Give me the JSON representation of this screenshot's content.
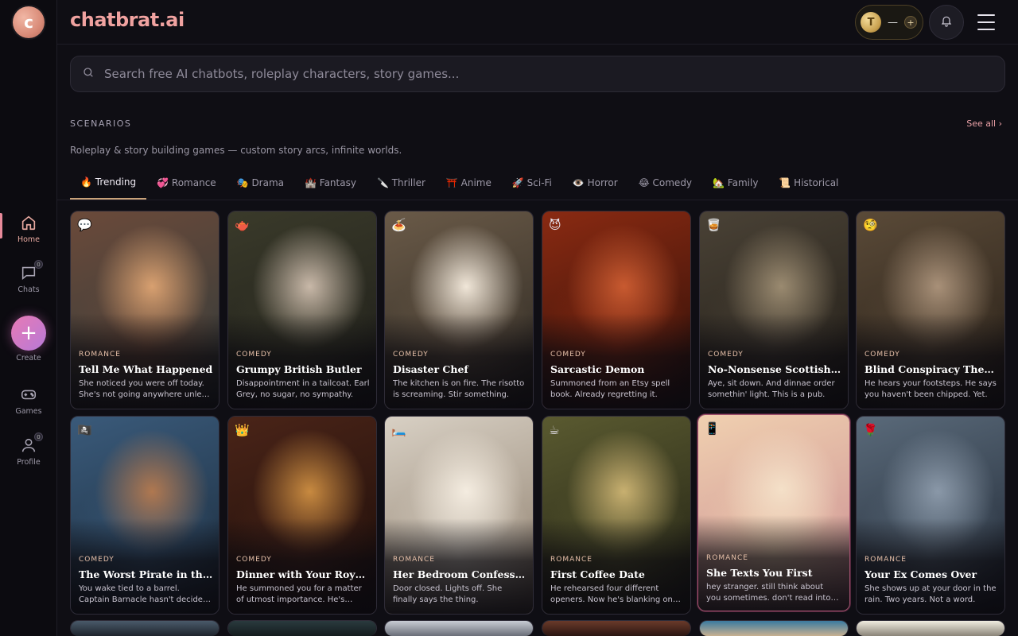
{
  "app": {
    "brand": "chatbrat.ai",
    "logo_letter": "c",
    "coins_value": "—",
    "coins_plus": "+"
  },
  "sidebar": {
    "items": [
      {
        "label": "Home",
        "icon": "home-icon",
        "active": true
      },
      {
        "label": "Chats",
        "icon": "chat-bubble-icon",
        "badge": "0"
      },
      {
        "label": "Create",
        "icon": "plus-icon"
      },
      {
        "label": "Games",
        "icon": "gamepad-icon"
      },
      {
        "label": "Profile",
        "icon": "user-icon",
        "badge": "0"
      }
    ]
  },
  "search": {
    "placeholder": "Search free AI chatbots, roleplay characters, story games..."
  },
  "section": {
    "title": "SCENARIOS",
    "see_all": "See all ›",
    "subtitle": "Roleplay & story building games — custom story arcs, infinite worlds."
  },
  "tabs": [
    {
      "label": "🔥 Trending",
      "active": true
    },
    {
      "label": "💞 Romance"
    },
    {
      "label": "🎭 Drama"
    },
    {
      "label": "🏰 Fantasy"
    },
    {
      "label": "🔪 Thriller"
    },
    {
      "label": "⛩️ Anime"
    },
    {
      "label": "🚀 Sci-Fi"
    },
    {
      "label": "👁️ Horror"
    },
    {
      "label": "😂 Comedy"
    },
    {
      "label": "🏡 Family"
    },
    {
      "label": "📜 Historical"
    }
  ],
  "cards": [
    {
      "emoji": "💬",
      "genre": "ROMANCE",
      "title": "Tell Me What Happened",
      "desc": "She noticed you were off today. She's not going anywhere unless you tell her.",
      "colors": [
        "#6b4a3a",
        "#2e3a3a",
        "#d8a070"
      ]
    },
    {
      "emoji": "🫖",
      "genre": "COMEDY",
      "title": "Grumpy British Butler",
      "desc": "Disappointment in a tailcoat. Earl Grey, no sugar, no sympathy.",
      "colors": [
        "#3a3a2a",
        "#1c1c18",
        "#c8b8a8"
      ]
    },
    {
      "emoji": "🍝",
      "genre": "COMEDY",
      "title": "Disaster Chef",
      "desc": "The kitchen is on fire. The risotto is screaming. Stir something.",
      "colors": [
        "#6a5a48",
        "#2a2620",
        "#f0e6d8"
      ]
    },
    {
      "emoji": "😈",
      "genre": "COMEDY",
      "title": "Sarcastic Demon",
      "desc": "Summoned from an Etsy spell book. Already regretting it.",
      "colors": [
        "#8a2a12",
        "#2a0e08",
        "#c85a30"
      ]
    },
    {
      "emoji": "🥃",
      "genre": "COMEDY",
      "title": "No-Nonsense Scottish Pub Owner",
      "desc": "Aye, sit down. And dinnae order somethin' light. This is a pub.",
      "colors": [
        "#4a4236",
        "#1e1a14",
        "#9a8a70"
      ]
    },
    {
      "emoji": "🧐",
      "genre": "COMEDY",
      "title": "Blind Conspiracy Theorist",
      "desc": "He hears your footsteps. He says you haven't been chipped. Yet.",
      "colors": [
        "#5a4a38",
        "#241c14",
        "#a89078"
      ]
    },
    {
      "emoji": "🏴‍☠️",
      "genre": "COMEDY",
      "title": "The Worst Pirate in the Caribbean",
      "desc": "You wake tied to a barrel. Captain Barnacle hasn't decided if you're crew or cargo.",
      "colors": [
        "#3a5a7a",
        "#1a2a3a",
        "#b07850"
      ]
    },
    {
      "emoji": "👑",
      "genre": "COMEDY",
      "title": "Dinner with Your Royal Highness",
      "desc": "He summoned you for a matter of utmost importance. He's already eating.",
      "colors": [
        "#4a2418",
        "#1a0c08",
        "#c88a40"
      ]
    },
    {
      "emoji": "🛏️",
      "genre": "ROMANCE",
      "title": "Her Bedroom Confession",
      "desc": "Door closed. Lights off. She finally says the thing.",
      "colors": [
        "#d8d0c4",
        "#8a7a68",
        "#f4ece0"
      ]
    },
    {
      "emoji": "☕",
      "genre": "ROMANCE",
      "title": "First Coffee Date",
      "desc": "He rehearsed four different openers. Now he's blanking on all of them.",
      "colors": [
        "#5a5a30",
        "#1e1e12",
        "#c8b070"
      ]
    },
    {
      "emoji": "📱",
      "genre": "ROMANCE",
      "title": "She Texts You First",
      "desc": "hey stranger. still think about you sometimes. don't read into it...",
      "colors": [
        "#f0d0b0",
        "#c88a90",
        "#f4e0c8"
      ]
    },
    {
      "emoji": "🌹",
      "genre": "ROMANCE",
      "title": "Your Ex Comes Over",
      "desc": "She shows up at your door in the rain. Two years. Not a word.",
      "colors": [
        "#5a6a7a",
        "#1c2430",
        "#8a98a8"
      ]
    }
  ]
}
